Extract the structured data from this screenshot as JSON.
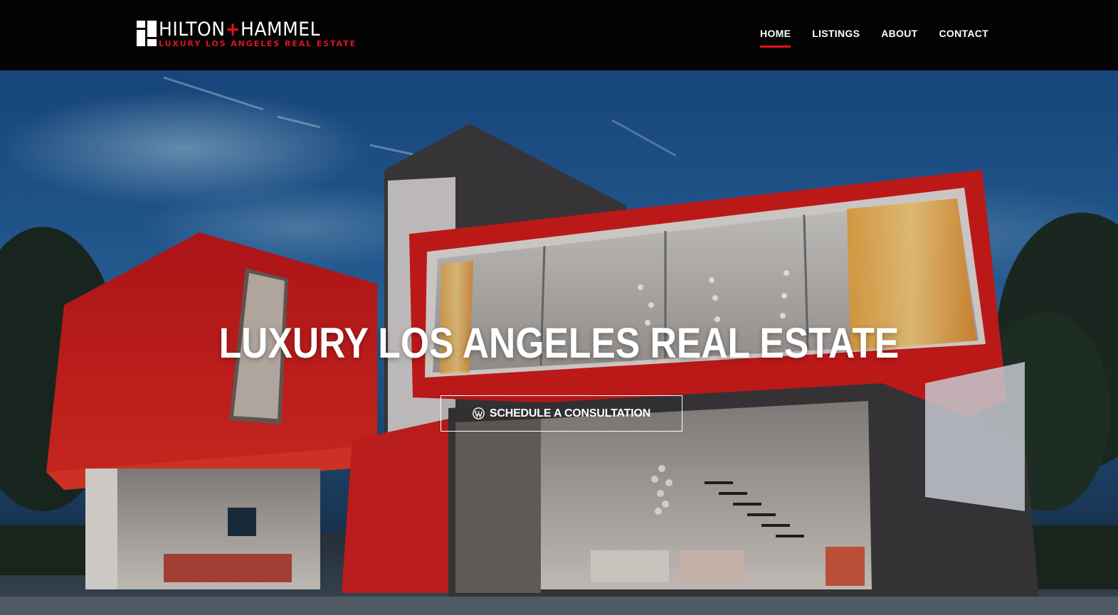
{
  "brand": {
    "name_left": "HILTON",
    "name_plus": "+",
    "name_right": "HAMMEL",
    "tagline": "LUXURY LOS ANGELES REAL ESTATE",
    "accent_color": "#e0141e"
  },
  "nav": {
    "items": [
      {
        "label": "HOME",
        "active": true
      },
      {
        "label": "LISTINGS",
        "active": false
      },
      {
        "label": "ABOUT",
        "active": false
      },
      {
        "label": "CONTACT",
        "active": false
      }
    ]
  },
  "hero": {
    "title": "LUXURY LOS ANGELES REAL ESTATE",
    "cta_label": "SCHEDULE A CONSULTATION",
    "cta_icon": "wordpress-icon",
    "background": "modern-red-house-at-dusk-image"
  }
}
